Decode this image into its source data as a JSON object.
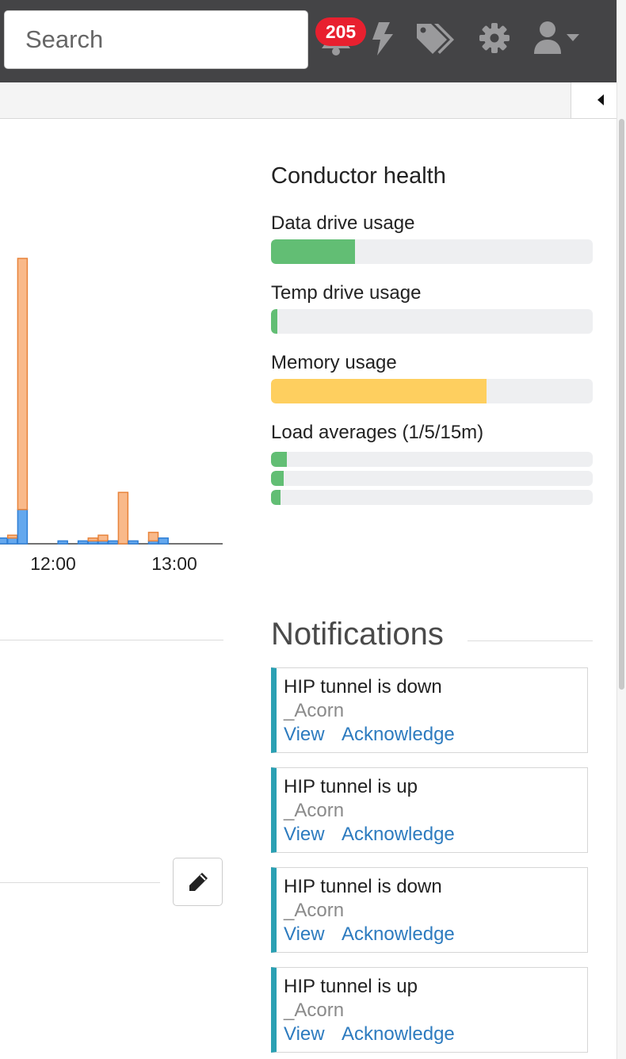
{
  "navbar": {
    "search_placeholder": "Search",
    "alerts_badge": "205",
    "icons": [
      "bell-icon",
      "lightning-icon",
      "tags-icon",
      "gear-icon",
      "user-icon",
      "caret-down-icon"
    ]
  },
  "colors": {
    "navbar": "#444446",
    "badge": "#e8202f",
    "green": "#62be74",
    "yellow": "#fecf5f",
    "bar_orange": "#f9b98a",
    "bar_blue": "#64a8ee",
    "accent": "#2aa0b3",
    "link": "#2d7bbf"
  },
  "chart_data": {
    "type": "bar",
    "stacked": true,
    "x_tick_labels": [
      "12:00",
      "13:00"
    ],
    "series": [
      {
        "values": [
          0.02,
          0.02,
          0.12,
          0,
          0,
          0,
          0.01,
          0,
          0.01,
          0.01,
          0.01,
          0.01,
          0,
          0.01,
          0,
          0.01,
          0.02
        ]
      },
      {
        "values": [
          0,
          0.01,
          0.88,
          0,
          0,
          0,
          0,
          0,
          0,
          0.01,
          0.02,
          0,
          0.18,
          0,
          0,
          0.03,
          0
        ]
      }
    ]
  },
  "health": {
    "title": "Conductor health",
    "metrics": [
      {
        "label": "Data drive usage",
        "value": 0.26,
        "color": "#62be74"
      },
      {
        "label": "Temp drive usage",
        "value": 0.02,
        "color": "#62be74"
      },
      {
        "label": "Memory usage",
        "value": 0.67,
        "color": "#fecf5f"
      }
    ],
    "load": {
      "label": "Load averages (1/5/15m)",
      "values": [
        0.05,
        0.04,
        0.03
      ],
      "color": "#62be74"
    }
  },
  "notifications": {
    "title": "Notifications",
    "items": [
      {
        "title": "HIP tunnel is down",
        "source": "_Acorn",
        "view": "View",
        "acknowledge": "Acknowledge"
      },
      {
        "title": "HIP tunnel is up",
        "source": "_Acorn",
        "view": "View",
        "acknowledge": "Acknowledge"
      },
      {
        "title": "HIP tunnel is down",
        "source": "_Acorn",
        "view": "View",
        "acknowledge": "Acknowledge"
      },
      {
        "title": "HIP tunnel is up",
        "source": "_Acorn",
        "view": "View",
        "acknowledge": "Acknowledge"
      }
    ]
  }
}
